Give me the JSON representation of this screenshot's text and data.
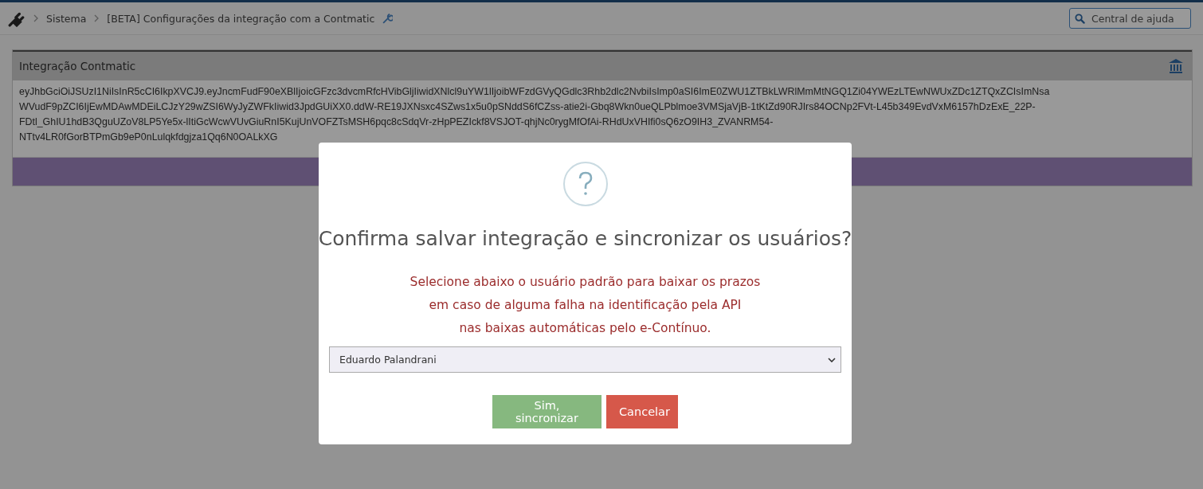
{
  "breadcrumb": {
    "items": [
      "Sistema",
      "[BETA] Configurações da integração com a Contmatic"
    ]
  },
  "help_search": {
    "placeholder": "Central de ajuda"
  },
  "panel": {
    "title": "Integração Contmatic",
    "token_lines": [
      "eyJhbGciOiJSUzI1NiIsInR5cCI6IkpXVCJ9.eyJncmFudF90eXBlIjoicGFzc3dvcmRfcHVibGljIiwidXNlcl9uYW1lIjoibWFzdGVyQGdlc3Rhb2dlc2NvbiIsImp0aSI6ImE0ZWU1ZTBkLWRlMmMtNGQ1Zi04YWEzLTEwNWUxZDc1ZTQxZCIsImNsa",
      "WVudF9pZCI6IjEwMDAwMDEiLCJzY29wZSI6WyJyZWFkIiwid3JpdGUiXX0.ddW-RE19JXNsxc4SZws1x5u0pSNddS6fCZss-atie2i-Gbq8Wkn0ueQLPblmoe3VMSjaVjB-1tKtZd90RJIrs84OCNp2FVt-L45b349EvdVxM6157hDzExE_22P-",
      "FDtl_GhIU1hdB3QguUZoV8LP5Ye5x-lItiGcWcwVUvGiuRnI5KujUnVOFZTsMSH6pqc8cSdqVr-zHpPEZIckf8VSJOT-qhjNc0rygMfOfAi-RHdUxVHIfi0sQ6zO9IH3_ZVANRM54-",
      "NTtv4LR0fGorBTPmGb9eP0nLulqkfdgjza1Qq6N0OALkXG"
    ]
  },
  "dialog": {
    "title": "Confirma salvar integração e sincronizar os usuários?",
    "message_lines": [
      "Selecione abaixo o usuário padrão para baixar os prazos",
      "em caso de alguma falha na identificação pela API",
      "nas baixas automáticas pelo e-Contínuo."
    ],
    "selected_user": "Eduardo Palandrani",
    "buttons": [
      {
        "label": "Sim, sincronizar",
        "kind": "confirm"
      },
      {
        "label": "Cancelar",
        "kind": "cancel"
      }
    ]
  }
}
